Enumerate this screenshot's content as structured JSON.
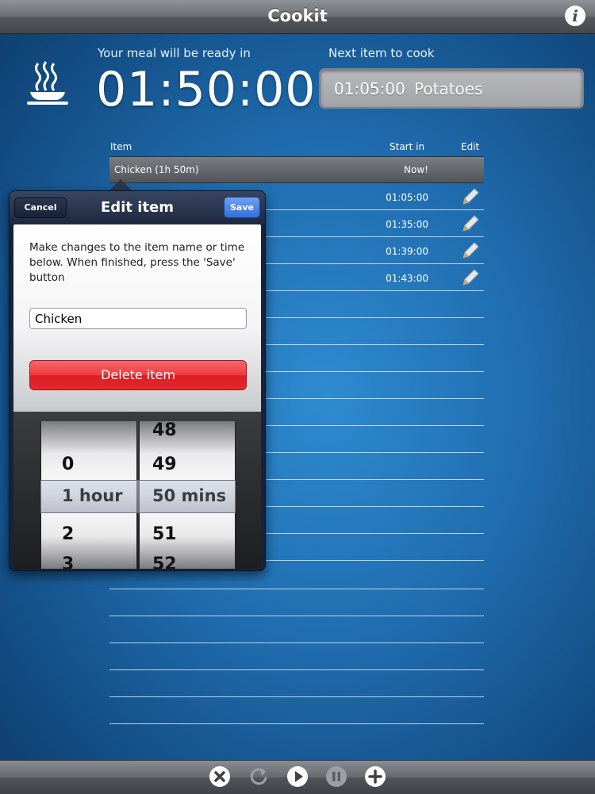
{
  "app": {
    "title": "Cookit",
    "info_label": "i"
  },
  "header": {
    "ready_label": "Your meal will be ready in",
    "ready_time": "01:50:00",
    "next_label": "Next item to cook",
    "next_time": "01:05:00",
    "next_name": "Potatoes"
  },
  "table": {
    "columns": {
      "item": "Item",
      "start": "Start in",
      "edit": "Edit"
    },
    "rows": [
      {
        "name": "Chicken (1h 50m)",
        "start": "Now!"
      },
      {
        "name": "",
        "start": "01:05:00"
      },
      {
        "name": "",
        "start": "01:35:00"
      },
      {
        "name": "",
        "start": "01:39:00"
      },
      {
        "name": "",
        "start": "01:43:00"
      }
    ]
  },
  "edit_popover": {
    "title": "Edit item",
    "cancel_label": "Cancel",
    "save_label": "Save",
    "message": "Make changes to the item name or time below. When finished, press the 'Save' button",
    "name_value": "Chicken",
    "delete_label": "Delete item",
    "picker": {
      "hours": [
        "0",
        "1 hour",
        "2",
        "3"
      ],
      "minutes": [
        "48",
        "49",
        "50 mins",
        "51",
        "52"
      ],
      "selected_hours": "1 hour",
      "selected_minutes": "50 mins"
    }
  },
  "toolbar": {
    "icons": [
      "close-circle-icon",
      "refresh-icon",
      "play-icon",
      "pause-icon",
      "add-icon"
    ]
  },
  "colors": {
    "accent_blue": "#1f6cae",
    "delete_red": "#e02a30",
    "save_blue": "#2f6fdc"
  }
}
